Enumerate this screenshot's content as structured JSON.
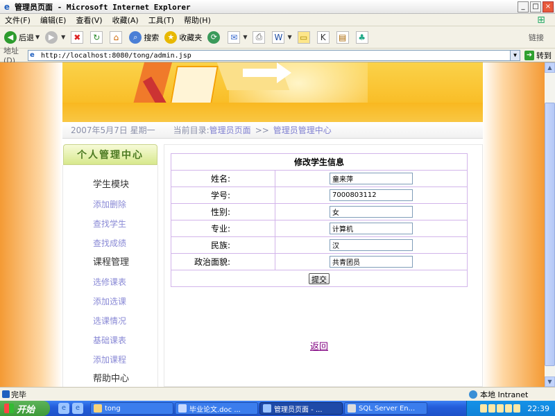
{
  "window": {
    "title": "管理员页面 - Microsoft Internet Explorer",
    "buttons": {
      "minimize": "_",
      "maximize": "□",
      "close": "×"
    }
  },
  "menu": [
    "文件(F)",
    "编辑(E)",
    "查看(V)",
    "收藏(A)",
    "工具(T)",
    "帮助(H)"
  ],
  "toolbar": {
    "back": "后退",
    "search": "搜索",
    "favorites": "收藏夹",
    "links": "链接"
  },
  "address": {
    "label": "地址(D)",
    "url": "http://localhost:8080/tong/admin.jsp",
    "go": "转到"
  },
  "page": {
    "date": "2007年5月7日  星期一",
    "current_dir_label": "当前目录:",
    "crumb1": "管理员页面",
    "crumb_sep": ">>",
    "crumb2": "管理员管理中心",
    "sidebar": {
      "title": "个人管理中心",
      "section1": "学生模块",
      "s1_links": [
        "添加删除",
        "查找学生",
        "查找成绩"
      ],
      "section2": "课程管理",
      "s2_links": [
        "选修课表",
        "添加选课",
        "选课情况",
        "基础课表",
        "添加课程"
      ],
      "section3": "帮助中心"
    },
    "form": {
      "title": "修改学生信息",
      "rows": [
        {
          "label": "姓名:",
          "value": "童来萍"
        },
        {
          "label": "学号:",
          "value": "7000803112"
        },
        {
          "label": "性别:",
          "value": "女"
        },
        {
          "label": "专业:",
          "value": "计算机"
        },
        {
          "label": "民族:",
          "value": "汉"
        },
        {
          "label": "政治面貌:",
          "value": "共青团员"
        }
      ],
      "submit": "提交"
    },
    "back_link": "返回"
  },
  "status": {
    "text": "完毕",
    "zone": "本地 Intranet"
  },
  "taskbar": {
    "start": "开始",
    "tasks": [
      "tong",
      "毕业论文.doc ...",
      "管理员页面 - ...",
      "SQL Server En..."
    ],
    "clock": "22:39"
  }
}
